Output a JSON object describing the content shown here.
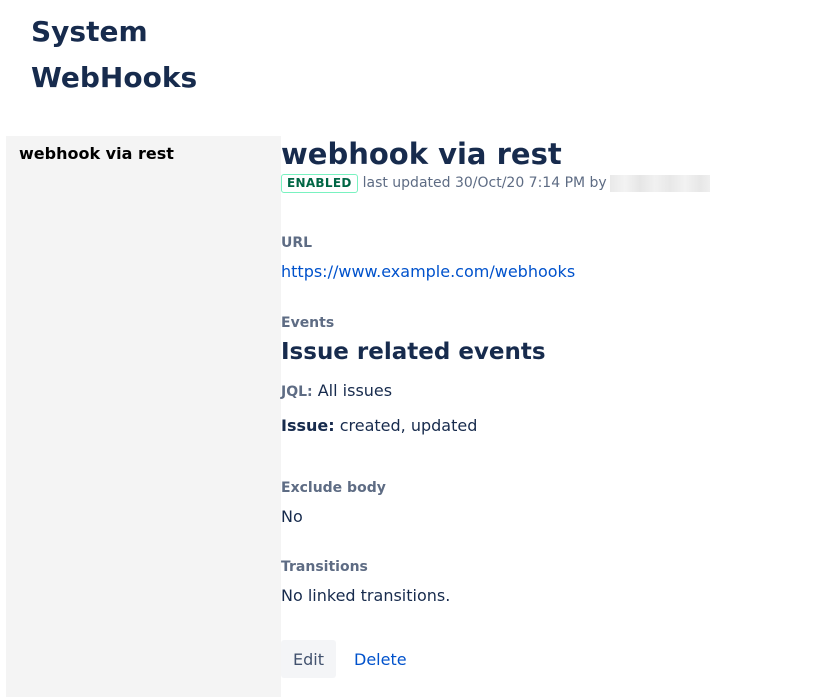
{
  "header": {
    "breadcrumb": "System",
    "title": "WebHooks"
  },
  "sidebar": {
    "items": [
      {
        "label": "webhook via rest"
      }
    ]
  },
  "webhook": {
    "name": "webhook via rest",
    "status": "ENABLED",
    "last_updated": "last updated 30/Oct/20 7:14 PM by"
  },
  "url": {
    "label": "URL",
    "value": "https://www.example.com/webhooks"
  },
  "events": {
    "label": "Events",
    "heading": "Issue related events",
    "jql_label": "JQL:",
    "jql_value": "All issues",
    "issue_label": "Issue:",
    "issue_value": "created, updated"
  },
  "exclude_body": {
    "label": "Exclude body",
    "value": "No"
  },
  "transitions": {
    "label": "Transitions",
    "value": "No linked transitions."
  },
  "actions": {
    "edit_label": "Edit",
    "delete_label": "Delete"
  },
  "colors": {
    "text": "#172b4d",
    "subtle_text": "#5e6c84",
    "link": "#0052cc",
    "badge_text": "#006644",
    "badge_border": "#79f2c0",
    "sidebar_bg": "#f4f4f4"
  }
}
